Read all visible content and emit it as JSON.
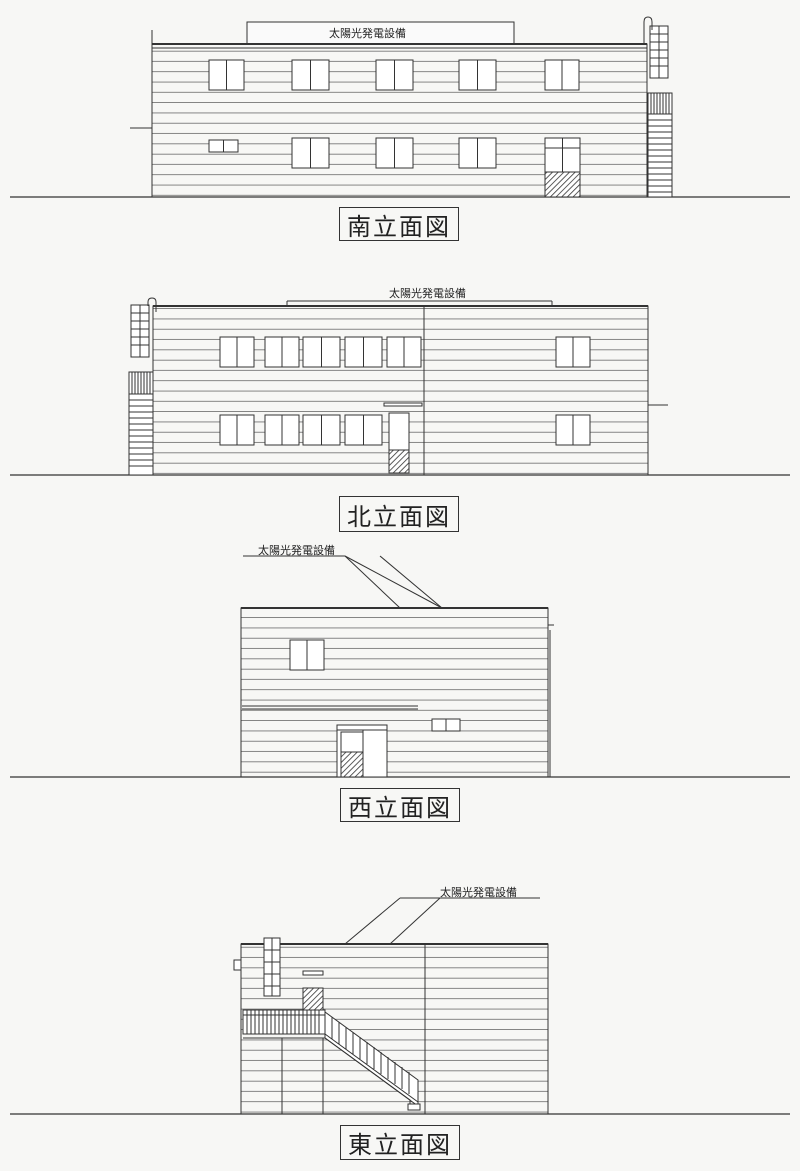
{
  "elevations": [
    {
      "title": "南立面図",
      "annotation": "太陽光発電設備"
    },
    {
      "title": "北立面図",
      "annotation": "太陽光発電設備"
    },
    {
      "title": "西立面図",
      "annotation": "太陽光発電設備"
    },
    {
      "title": "東立面図",
      "annotation": "太陽光発電設備"
    }
  ]
}
